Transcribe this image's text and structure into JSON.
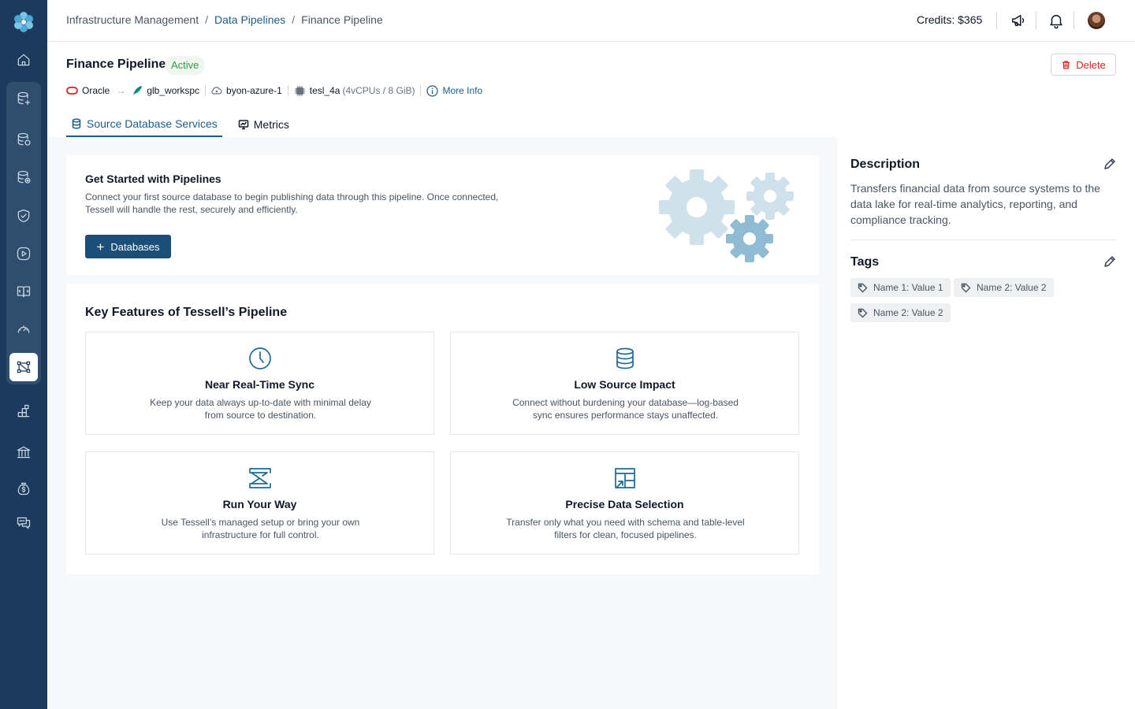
{
  "breadcrumb": {
    "root": "Infrastructure Management",
    "section": "Data Pipelines",
    "current": "Finance Pipeline",
    "separator": "/"
  },
  "header": {
    "credits": "Credits: $365"
  },
  "page": {
    "title": "Finance Pipeline",
    "status": "Active",
    "delete_label": "Delete"
  },
  "meta": {
    "source": "Oracle",
    "workspace": "glb_workspc",
    "cloud": "byon-azure-1",
    "compute": "tesl_4a",
    "compute_spec": "(4vCPUs / 8 GiB)",
    "more_info": "More Info"
  },
  "tabs": [
    {
      "label": "Source Database Services",
      "icon": "database-icon",
      "active": true
    },
    {
      "label": "Metrics",
      "icon": "chart-icon",
      "active": false
    }
  ],
  "get_started": {
    "title": "Get Started with Pipelines",
    "description": "Connect your first source database to begin publishing data through this pipeline. Once connected, Tessell will handle the rest, securely and efficiently.",
    "button": "Databases"
  },
  "features": {
    "title": "Key Features of Tessell’s Pipeline",
    "items": [
      {
        "icon": "clock-icon",
        "title": "Near Real-Time Sync",
        "desc": "Keep your data always up-to-date with minimal delay from source to destination."
      },
      {
        "icon": "database-icon",
        "title": "Low Source Impact",
        "desc": "Connect without burdening your database—log-based sync ensures performance stays unaffected."
      },
      {
        "icon": "route-icon",
        "title": "Run Your Way",
        "desc": "Use Tessell’s managed setup or bring your own infrastructure for full control."
      },
      {
        "icon": "table-select-icon",
        "title": "Precise Data Selection",
        "desc": "Transfer only what you need with schema and table-level filters for clean, focused pipelines."
      }
    ]
  },
  "description": {
    "title": "Description",
    "text": "Transfers financial data from source systems to the data lake for real-time analytics, reporting, and compliance tracking."
  },
  "tags": {
    "title": "Tags",
    "items": [
      "Name 1: Value 1",
      "Name 2: Value 2",
      "Name 2: Value 2"
    ]
  },
  "colors": {
    "sidebar": "#1b3a5c",
    "accent": "#1d5d8c",
    "primary_button": "#1b4f7a",
    "danger": "#dc2626",
    "success": "#2e9e45"
  }
}
